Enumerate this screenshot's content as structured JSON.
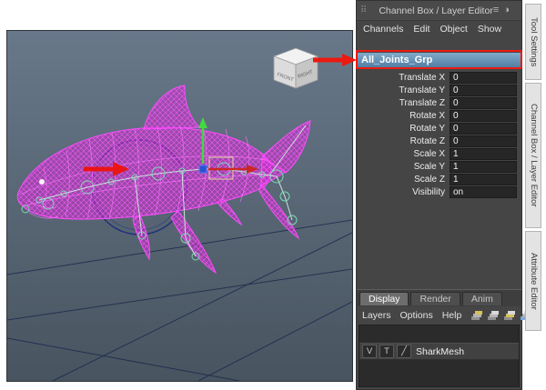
{
  "viewport": {
    "view_cube": {
      "front": "FRONT",
      "right": "RIGHT"
    }
  },
  "channel_box": {
    "title": "Channel Box / Layer Editor",
    "menus": [
      "Channels",
      "Edit",
      "Object",
      "Show"
    ],
    "selected_object": "All_Joints_Grp",
    "attributes": [
      {
        "label": "Translate X",
        "value": "0"
      },
      {
        "label": "Translate Y",
        "value": "0"
      },
      {
        "label": "Translate Z",
        "value": "0"
      },
      {
        "label": "Rotate X",
        "value": "0"
      },
      {
        "label": "Rotate Y",
        "value": "0"
      },
      {
        "label": "Rotate Z",
        "value": "0"
      },
      {
        "label": "Scale X",
        "value": "1"
      },
      {
        "label": "Scale Y",
        "value": "1"
      },
      {
        "label": "Scale Z",
        "value": "1"
      },
      {
        "label": "Visibility",
        "value": "on"
      }
    ]
  },
  "layer_editor": {
    "tabs": [
      "Display",
      "Render",
      "Anim"
    ],
    "active_tab": "Display",
    "menus": [
      "Layers",
      "Options",
      "Help"
    ],
    "layer_row": {
      "visibility": "V",
      "template": "T",
      "name": "SharkMesh"
    }
  },
  "side_tabs": [
    "Tool Settings",
    "Channel Box / Layer Editor",
    "Attribute Editor"
  ],
  "icons": {
    "grip": "⠿",
    "half_circle": "◑",
    "slider": "≡",
    "layer_type": "╱"
  },
  "colors": {
    "annotation_red": "#ec1a10",
    "selection_blue": "#517ea4",
    "wireframe_magenta": "#ff4dff",
    "panel_bg": "#454545"
  }
}
